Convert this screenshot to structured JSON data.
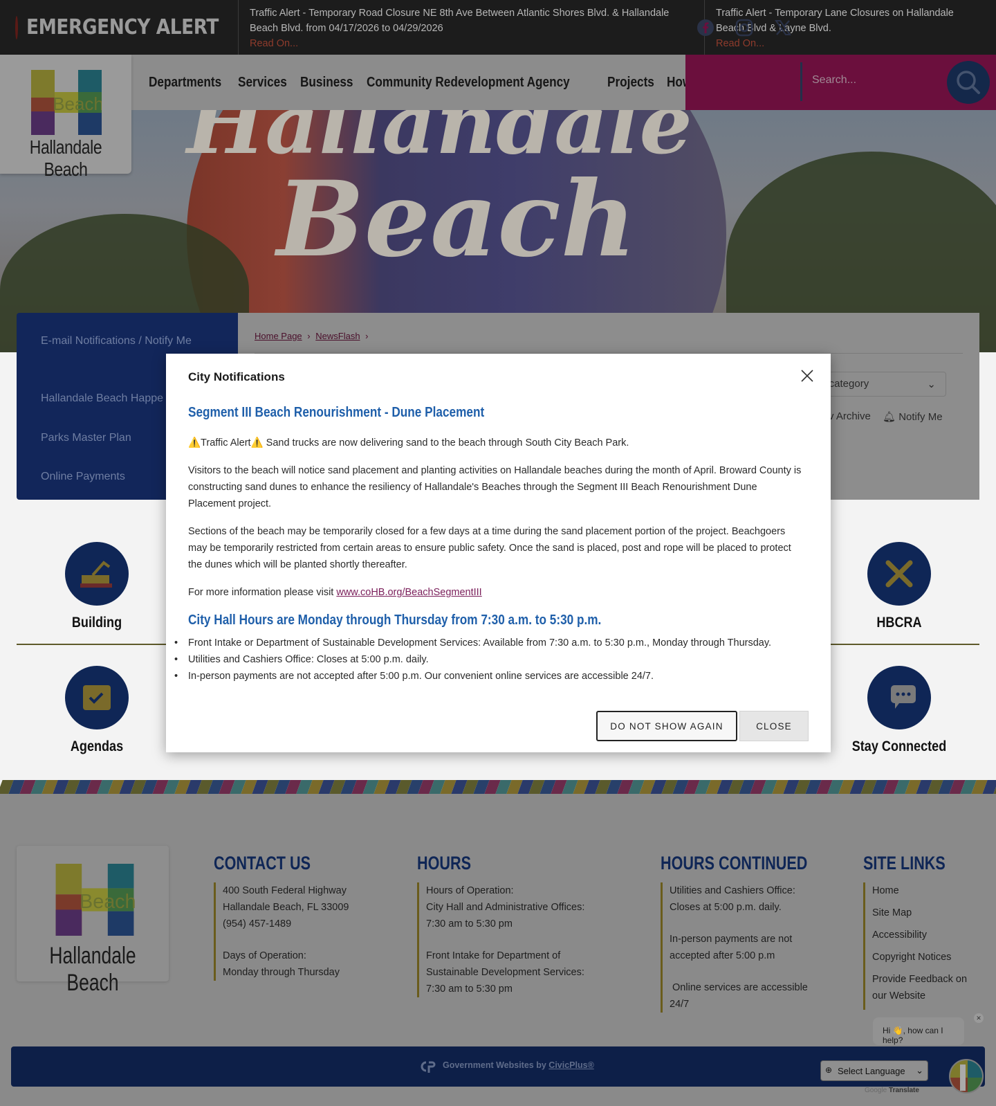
{
  "alert": {
    "label": "EMERGENCY ALERT",
    "items": [
      {
        "text": "Traffic Alert - Temporary Road Closure NE 8th Ave Between Atlantic Shores Blvd. & Hallandale Beach Blvd. from 04/17/2026 to 04/29/2026",
        "link": "Read On..."
      },
      {
        "text": "Traffic Alert - Temporary Lane Closures on Hallandale Beach Blvd & Layne Blvd.",
        "link": "Read On..."
      }
    ]
  },
  "logo": {
    "word_overlay": "Beach",
    "name": "Hallandale Beach"
  },
  "nav": [
    "Departments",
    "Services",
    "Business",
    "Community Redevelopment Agency",
    "Projects",
    "How Do I..."
  ],
  "search": {
    "placeholder": "Search..."
  },
  "sidebar": {
    "items": [
      "E-mail Notifications / Notify Me",
      "Hallandale Beach Happe",
      "Parks Master Plan",
      "Online Payments"
    ]
  },
  "breadcrumb": {
    "home": "Home Page",
    "current": "NewsFlash",
    "sep": "›"
  },
  "filters": {
    "category": "y category",
    "archive": "v Archive",
    "notify": "Notify Me"
  },
  "tiles": [
    "Building",
    "HBCRA",
    "Agendas",
    "Stay Connected"
  ],
  "modal": {
    "title": "City Notifications",
    "news1": {
      "heading": "Segment III Beach Renourishment - Dune Placement",
      "p1": "⚠️Traffic Alert⚠️ Sand trucks are now delivering sand to the beach through South City Beach Park.",
      "p2": "Visitors to the beach will notice sand placement and planting activities on Hallandale beaches during the month of April.  Broward County is constructing sand dunes to enhance the resiliency of Hallandale's Beaches through the Segment III Beach Renourishment Dune Placement project.",
      "p3": "Sections of the beach may be temporarily closed for a few days at a time during the sand placement portion of the project.  Beachgoers may be temporarily restricted from certain areas to ensure public safety.  Once the sand is placed, post and rope will be placed to protect the dunes which will be planted shortly thereafter.",
      "p4_prefix": "For more information please visit ",
      "p4_link": "www.coHB.org/BeachSegmentIII"
    },
    "news2": {
      "heading": "City Hall Hours are Monday through Thursday from 7:30 a.m. to 5:30 p.m.",
      "bullets": [
        "Front Intake or Department of Sustainable Development Services: Available from 7:30 a.m. to 5:30 p.m., Monday through Thursday.",
        "Utilities and Cashiers Office: Closes at 5:00 p.m. daily.",
        "In-person payments are not accepted after 5:00 p.m. Our convenient online services are accessible 24/7."
      ]
    },
    "buttons": {
      "dont_show": "DO NOT SHOW AGAIN",
      "close": "CLOSE"
    }
  },
  "footer": {
    "contact": {
      "heading": "CONTACT US",
      "address1": "400 South Federal Highway",
      "address2": "Hallandale Beach, FL 33009",
      "phone": "(954) 457-1489",
      "days_label": "Days of Operation:",
      "days": "Monday through Thursday"
    },
    "hours": {
      "heading": "HOURS",
      "l1": "Hours of Operation:",
      "l2": "City Hall and Administrative Offices:",
      "l3": "7:30 am to 5:30 pm",
      "l4": "Front Intake for Department of",
      "l5": "Sustainable Development Services:",
      "l6": "7:30 am to 5:30 pm"
    },
    "hours2": {
      "heading": "HOURS CONTINUED",
      "l1": "Utilities and Cashiers Office:",
      "l2": "Closes at 5:00 p.m. daily.",
      "l3": "In-person payments are not",
      "l4": "accepted after 5:00 p.m",
      "l5": " Online services are accessible",
      "l6": "24/7"
    },
    "links": {
      "heading": "SITE LINKS",
      "items": [
        "Home",
        "Site Map",
        "Accessibility",
        "Copyright Notices",
        "Provide Feedback on",
        "our Website"
      ]
    },
    "civic": {
      "prefix": "Government Websites by ",
      "brand": "CivicPlus®"
    },
    "chat": "Hi 👋, how can I help?",
    "lang": "Select Language",
    "translate": "Translate",
    "google": "Google"
  }
}
